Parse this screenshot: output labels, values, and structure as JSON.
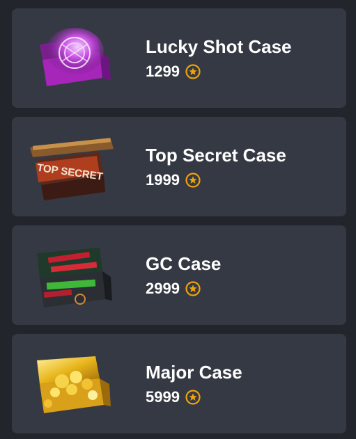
{
  "colors": {
    "background": "#22252b",
    "card": "#353943",
    "text": "#ffffff",
    "coin": "#f0a30a"
  },
  "currency_icon": "coin-star-icon",
  "cases": [
    {
      "name": "Lucky Shot Case",
      "price": "1299",
      "image_icon": "lucky-shot-case-image"
    },
    {
      "name": "Top Secret Case",
      "price": "1999",
      "image_icon": "top-secret-case-image",
      "image_text": "TOP SECRET"
    },
    {
      "name": "GC Case",
      "price": "2999",
      "image_icon": "gc-case-image"
    },
    {
      "name": "Major Case",
      "price": "5999",
      "image_icon": "major-case-image"
    }
  ]
}
